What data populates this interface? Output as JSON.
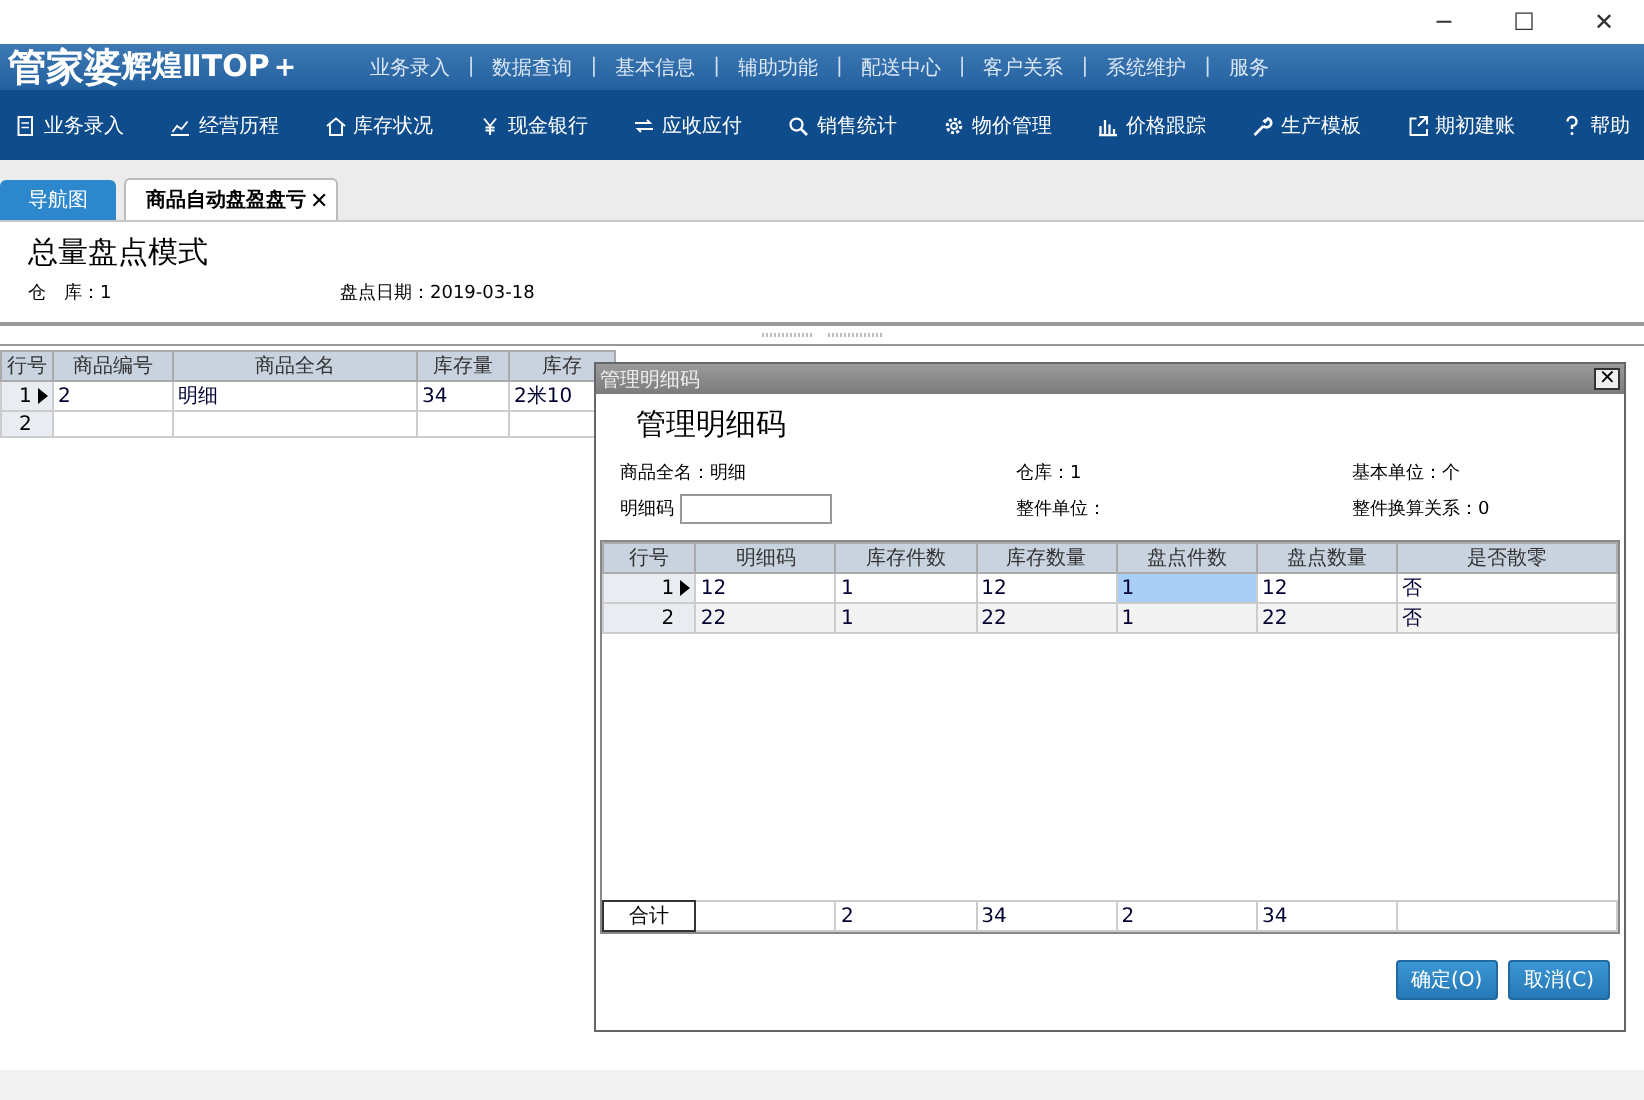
{
  "window": {
    "controls": [
      "─",
      "☐",
      "✕"
    ]
  },
  "banner": {
    "logo": "管家婆",
    "logo_sub": "辉煌ⅡTOP＋",
    "menu": [
      "业务录入",
      "数据查询",
      "基本信息",
      "辅助功能",
      "配送中心",
      "客户关系",
      "系统维护",
      "服务"
    ],
    "separator": "|"
  },
  "toolbar": [
    {
      "label": "业务录入",
      "kind": "doc"
    },
    {
      "label": "经营历程",
      "kind": "chart"
    },
    {
      "label": "库存状况",
      "kind": "home"
    },
    {
      "label": "现金银行",
      "kind": "yen"
    },
    {
      "label": "应收应付",
      "kind": "arrows"
    },
    {
      "label": "销售统计",
      "kind": "search"
    },
    {
      "label": "物价管理",
      "kind": "gear"
    },
    {
      "label": "价格跟踪",
      "kind": "bars"
    },
    {
      "label": "生产模板",
      "kind": "wrench"
    },
    {
      "label": "期初建账",
      "kind": "export"
    },
    {
      "label": "帮助",
      "kind": "help"
    }
  ],
  "tabs": [
    {
      "label": "导航图",
      "selected": false
    },
    {
      "label": "商品自动盘盈盘亏",
      "selected": true,
      "close": "✕"
    }
  ],
  "page": {
    "title": "总量盘点模式",
    "warehouse_label": "仓　库：",
    "warehouse": "1",
    "date_label": "盘点日期：",
    "date": "2019-03-18"
  },
  "table": {
    "columns": [
      "行号",
      "商品编号",
      "商品全名",
      "库存量",
      "库存"
    ],
    "rows": [
      {
        "selected": true,
        "cells": [
          "1",
          "2",
          "明细",
          "34",
          "2米10"
        ]
      },
      {
        "selected": false,
        "cells": [
          "2",
          "",
          "",
          "",
          ""
        ]
      }
    ]
  },
  "dialog": {
    "title": "管理明细码",
    "close": "✕",
    "heading": "管理明细码",
    "info": [
      {
        "label": "商品全名：",
        "value": "明细"
      },
      {
        "label": "仓库：",
        "value": "1"
      },
      {
        "label": "基本单位：",
        "value": "个"
      }
    ],
    "code_label": "明细码",
    "info2": [
      {
        "label": "整件单位："
      },
      {
        "label": "整件换算关系：",
        "value": "0"
      }
    ],
    "columns": [
      "行号",
      "明细码",
      "库存件数",
      "库存数量",
      "盘点件数",
      "盘点数量",
      "是否散零"
    ],
    "rows": [
      {
        "selected": true,
        "cells": [
          {
            "text": "1"
          },
          {
            "text": "12",
            "focused": false
          },
          {
            "text": "1",
            "focused": false
          },
          {
            "text": "12",
            "focused": false
          },
          {
            "text": "1",
            "focused": true
          },
          {
            "text": "12",
            "focused": false
          },
          {
            "text": "否",
            "focused": false
          }
        ]
      },
      {
        "selected": false,
        "cells": [
          {
            "text": "2"
          },
          {
            "text": "22",
            "focused": false
          },
          {
            "text": "1",
            "focused": false
          },
          {
            "text": "22",
            "focused": false
          },
          {
            "text": "1",
            "focused": false
          },
          {
            "text": "22",
            "focused": false
          },
          {
            "text": "否",
            "focused": false
          }
        ]
      }
    ],
    "total": {
      "label": "合计",
      "cells": [
        "",
        "2",
        "34",
        "2",
        "34",
        ""
      ]
    },
    "buttons": [
      "确定(O)",
      "取消(C)"
    ]
  }
}
